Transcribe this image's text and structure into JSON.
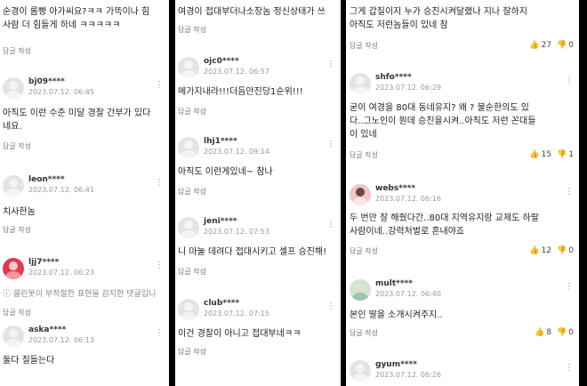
{
  "comments": [
    {
      "nick": "",
      "date": "",
      "text": "순경이 롬빵 아가씨요?ㅋㅋ 가뜩이나 힘\n사람 더 힘들게 하네 ㅋㅋㅋㅋㅋ",
      "reply": "답글 작성"
    },
    {
      "nick": "bj09****",
      "date": "2023.07.12. 06:45",
      "text": "아직도 이런 수준 미달 경찰 간부가 있다\n네요.",
      "reply": "답글 작성"
    },
    {
      "nick": "leon****",
      "date": "2023.07.12. 06:41",
      "text": "치사한놈",
      "reply": "답글 작성"
    },
    {
      "nick": "ljj7****",
      "date": "2023.07.12. 06:23",
      "text": "ⓘ 클린봇이 부적절한 표현을 감지한 댓글입니",
      "reply": "답글 작성"
    },
    {
      "nick": "aska****",
      "date": "2023.07.12. 06:13",
      "text": "둘다 질들는다",
      "reply": ""
    },
    {
      "nick": "",
      "date": "",
      "text": "여경이 접대부더나소장놈 정신상태가 쓰",
      "reply": "답글 작성"
    },
    {
      "nick": "ojc0****",
      "date": "2023.07.12. 06:57",
      "text": "메가지내라!!!더듬만진당1순위!!!",
      "reply": "답글 작성"
    },
    {
      "nick": "lhj1****",
      "date": "2023.07.12. 09:14",
      "text": "아직도 이런게있네~ 참나",
      "reply": "답글 작성"
    },
    {
      "nick": "jeni****",
      "date": "2023.07.12. 07:53",
      "text": "니 마눌 데려다 접대시키고 셀프 승진해!",
      "reply": "답글 작성"
    },
    {
      "nick": "club****",
      "date": "2023.07.12. 07:15",
      "text": "이건 경찰이 아니고 접대부네ㅋㅋ",
      "reply": "답글 작성"
    },
    {
      "nick": "",
      "date": "",
      "text": "그게 갑질이지 누가 승진시켜달랬나 지나 잘하지\n아직도 저런놈들이 있네 참",
      "reply": "답글 작성",
      "up": "27",
      "down": "0"
    },
    {
      "nick": "shfo****",
      "date": "2023.07.12. 06:29",
      "text": "굳이 여경을 80대 동네유지? 왜 ? 불순한의도 있\n다..그노인이 뭔데 승진을시켜..아직도 저런 꼰대들\n이 있네",
      "reply": "답글 작성",
      "up": "15",
      "down": "1"
    },
    {
      "nick": "webs****",
      "date": "2023.07.12. 06:16",
      "text": "두 번만 잘 해줬다간..80대 지역유지랑 교제도 하랄\n사람이네..강력처벌로 혼내야죠",
      "reply": "답글 작성",
      "up": "12",
      "down": "0"
    },
    {
      "nick": "mult****",
      "date": "2023.07.12. 06:40",
      "text": "본인 딸을 소개시켜주지..",
      "reply": "답글 작성",
      "up": "8",
      "down": "0"
    },
    {
      "nick": "gyum****",
      "date": "2023.07.12. 06:26",
      "text": "",
      "reply": ""
    }
  ],
  "icons": {
    "more": "vertical-dots-icon",
    "up": "thumbs-up-icon",
    "down": "thumbs-down-icon"
  }
}
